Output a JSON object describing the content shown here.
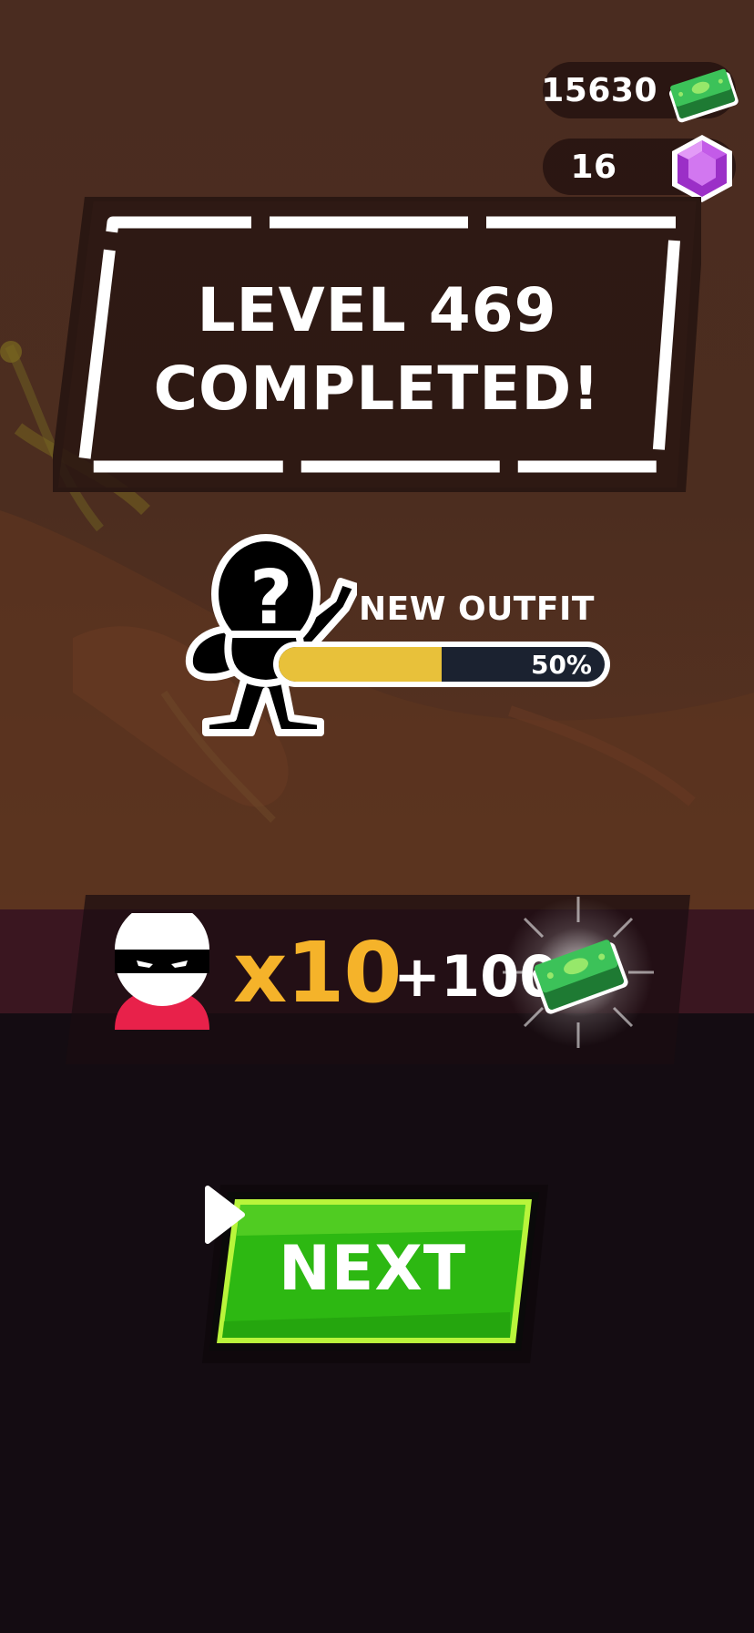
{
  "currency": {
    "cash": "15630",
    "gems": "16"
  },
  "level": {
    "line1": "LEVEL 469",
    "line2": "COMPLETED!"
  },
  "outfit": {
    "label": "NEW OUTFIT",
    "progress": 0.5,
    "progress_text": "50%",
    "mystery_mark": "?"
  },
  "reward": {
    "multiplier": "x10",
    "bonus": "+100"
  },
  "next_button": {
    "label": "NEXT"
  },
  "colors": {
    "progress_fill": "#e8c13a",
    "multiplier": "#f5b32a",
    "button_green": "#2db812",
    "button_border": "#b9f53b",
    "cash_green": "#2fa84a",
    "gem_purple": "#b34fd8",
    "thief_red": "#e8214a"
  },
  "icons": {
    "cash": "cash-stack-icon",
    "gem": "gem-icon",
    "arrow": "play-arrow-icon",
    "avatar": "thief-avatar",
    "silhouette": "mystery-outfit-silhouette"
  }
}
